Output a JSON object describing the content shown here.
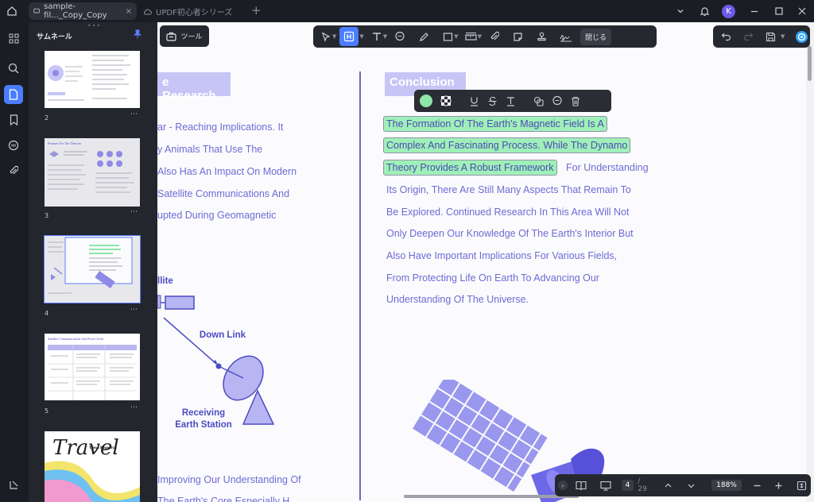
{
  "tabs": [
    {
      "label": "sample-fil..._Copy_Copy",
      "active": true
    },
    {
      "label": "UPDF初心者シリーズ",
      "active": false
    }
  ],
  "user": {
    "initial": "K"
  },
  "panel": {
    "title": "サムネール"
  },
  "thumbnails": [
    {
      "page": "2"
    },
    {
      "page": "3",
      "heading": "Features For The Theories"
    },
    {
      "page": "4"
    },
    {
      "page": "5",
      "heading": "Satellite Communications And Power Grids"
    },
    {
      "page": "",
      "heading": "Travel",
      "subheading": "Trend Research"
    }
  ],
  "toolbar": {
    "tools_label": "ツール",
    "close_label": "閉じる"
  },
  "document": {
    "left_heading": "e Research",
    "left_lines": [
      "ar - Reaching Implications. It",
      "y Animals That Use The",
      "Also Has An Impact On Modern",
      "Satellite Communications And",
      "upted During Geomagnetic"
    ],
    "left_bottom_lines": [
      "Improving Our Understanding Of",
      "The Earth's Core Especially H"
    ],
    "diagram": {
      "satellite_label": "llite",
      "downlink_label": "Down Link",
      "station_label_1": "Receiving",
      "station_label_2": "Earth Station"
    },
    "right_heading": "Conclusion",
    "highlighted_lines": [
      "The Formation Of The Earth's Magnetic Field Is A",
      "Complex And Fascinating Process. While The Dynamo",
      "Theory Provides A Robust Framework"
    ],
    "third_line_tail": "For Understanding",
    "right_lines": [
      "Its Origin, There Are Still Many Aspects That Remain To",
      "Be Explored. Continued Research In This Area Will Not",
      "Only Deepen Our Knowledge Of The Earth's Interior But",
      "Also Have Important Implications For Various Fields,",
      "From Protecting Life On Earth To Advancing Our",
      "Understanding Of The Universe."
    ]
  },
  "navigation": {
    "current_page": "4",
    "total_pages": "/ 29",
    "zoom": "188%"
  },
  "colors": {
    "accent": "#4a7dff",
    "highlight": "#9ff0b8",
    "text": "#6e6ad6",
    "heading_bg": "#c7c5f6"
  }
}
